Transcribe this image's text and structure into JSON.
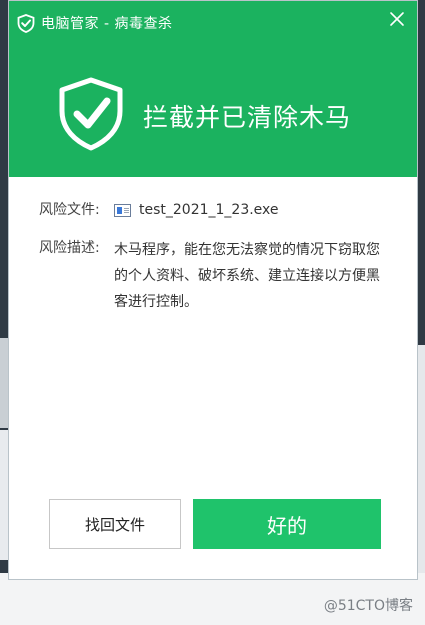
{
  "window": {
    "title": "电脑管家 - 病毒查杀",
    "close_icon": "close-icon"
  },
  "banner": {
    "message": "拦截并已清除木马",
    "icon": "shield-check-icon"
  },
  "details": {
    "file_label": "风险文件:",
    "file_name": "test_2021_1_23.exe",
    "file_icon": "executable-file-icon",
    "desc_label": "风险描述:",
    "desc_text": "木马程序，能在您无法察觉的情况下窃取您的个人资料、破坏系统、建立连接以方便黑客进行控制。"
  },
  "buttons": {
    "recover_label": "找回文件",
    "ok_label": "好的"
  },
  "watermark": {
    "text": "@51CTO博客"
  },
  "colors": {
    "header_green": "#1bb25f",
    "button_green": "#1fc36b"
  }
}
